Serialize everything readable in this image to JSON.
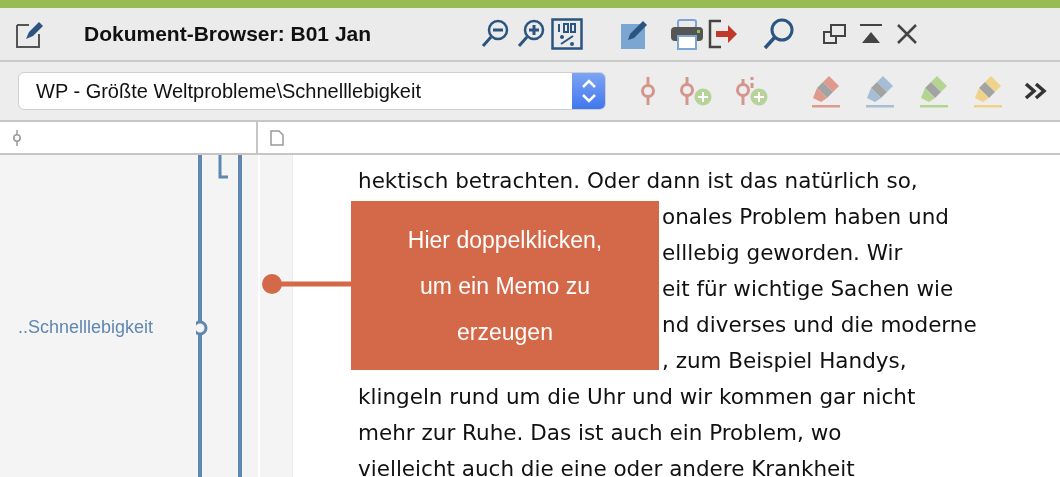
{
  "window": {
    "title": "Dokument-Browser: B01 Jan"
  },
  "toolbar": {
    "code_path": "WP - Größte Weltprobleme\\Schnelllebigkeit",
    "highlighters": [
      {
        "color": "#de9a8c"
      },
      {
        "color": "#a6bdd6"
      },
      {
        "color": "#b5d391"
      },
      {
        "color": "#efd38a"
      }
    ]
  },
  "code_column": {
    "label": "..Schnelllebigkeit"
  },
  "document": {
    "lines": [
      {
        "text": "hektisch betrachten. Oder dann ist das natürlich so,",
        "covered": false
      },
      {
        "text": "onales Problem haben und",
        "covered": true
      },
      {
        "text": "elllebig geworden. Wir",
        "covered": true
      },
      {
        "text": "eit für wichtige Sachen wie",
        "covered": true
      },
      {
        "text": "nd diverses und die moderne",
        "covered": true
      },
      {
        "text": ", zum Beispiel Handys,",
        "covered": true
      },
      {
        "text": "klingeln rund um die Uhr und wir kommen gar nicht",
        "covered": false
      },
      {
        "text": "mehr zur Ruhe. Das ist auch ein Problem, wo",
        "covered": false
      },
      {
        "text": "vielleicht auch die eine oder andere Krankheit",
        "covered": false
      }
    ]
  },
  "callout": {
    "text": "Hier doppelklicken, um ein Memo zu erzeugen"
  }
}
